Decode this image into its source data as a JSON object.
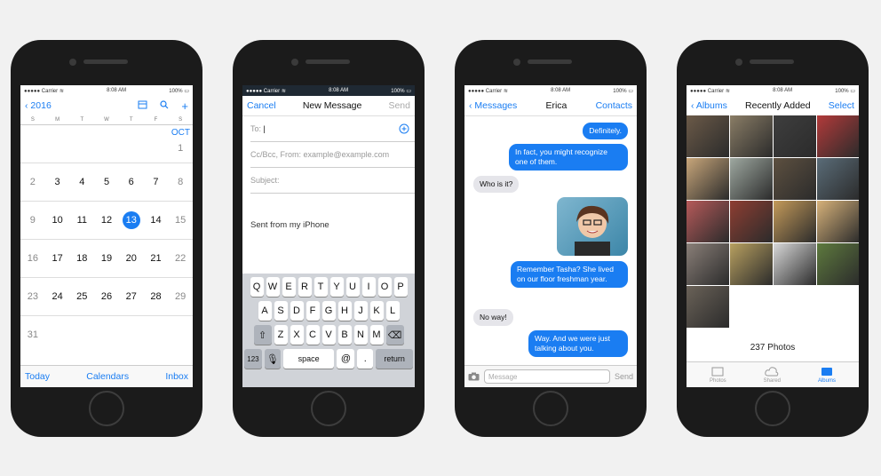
{
  "status": {
    "carrier": "Carrier",
    "time": "8:08 AM",
    "battery": "100%"
  },
  "calendar": {
    "back_label": "2016",
    "weekdays": [
      "S",
      "M",
      "T",
      "W",
      "T",
      "F",
      "S"
    ],
    "month": "OCT",
    "rows": [
      [
        "",
        "",
        "",
        "",
        "",
        "",
        "1"
      ],
      [
        "2",
        "3",
        "4",
        "5",
        "6",
        "7",
        "8"
      ],
      [
        "9",
        "10",
        "11",
        "12",
        "13",
        "14",
        "15"
      ],
      [
        "16",
        "17",
        "18",
        "19",
        "20",
        "21",
        "22"
      ],
      [
        "23",
        "24",
        "25",
        "26",
        "27",
        "28",
        "29"
      ],
      [
        "31",
        "",
        "",
        "",
        "",
        "",
        ""
      ]
    ],
    "today": "13",
    "tabs": [
      "Today",
      "Calendars",
      "Inbox"
    ]
  },
  "mail": {
    "cancel": "Cancel",
    "title": "New Message",
    "send": "Send",
    "to_label": "To:",
    "cc_placeholder": "Cc/Bcc, From: example@example.com",
    "subject_placeholder": "Subject:",
    "body": "Sent from my iPhone",
    "keys_row1": [
      "Q",
      "W",
      "E",
      "R",
      "T",
      "Y",
      "U",
      "I",
      "O",
      "P"
    ],
    "keys_row2": [
      "A",
      "S",
      "D",
      "F",
      "G",
      "H",
      "J",
      "K",
      "L"
    ],
    "keys_row3": [
      "Z",
      "X",
      "C",
      "V",
      "B",
      "N",
      "M"
    ],
    "key_numbers": "123",
    "key_space": "space",
    "key_at": "@",
    "key_dot": ".",
    "key_return": "return"
  },
  "messages": {
    "back": "Messages",
    "contact": "Erica",
    "contacts": "Contacts",
    "m1": "Definitely.",
    "m2": "In fact, you might recognize one of them.",
    "m3": "Who is it?",
    "m4": "Remember Tasha? She lived on our floor freshman year.",
    "m5": "No way!",
    "m6": "Way. And we were just talking about you.",
    "placeholder": "Message",
    "send": "Send"
  },
  "photos": {
    "back": "Albums",
    "title": "Recently Added",
    "select": "Select",
    "count": "237 Photos",
    "tabs": [
      "Photos",
      "Shared",
      "Albums"
    ],
    "tiles": [
      "#6b5a48",
      "#8a7d66",
      "#3e3e3e",
      "#b23a3a",
      "#c8a67a",
      "#9ea8a0",
      "#5d5040",
      "#5a6c78",
      "#b65a5a",
      "#8e3e32",
      "#c49a5a",
      "#d7b27a",
      "#8a7f78",
      "#b8a060",
      "#d8d8d8",
      "#5e7a3e",
      "#6a6258"
    ]
  }
}
